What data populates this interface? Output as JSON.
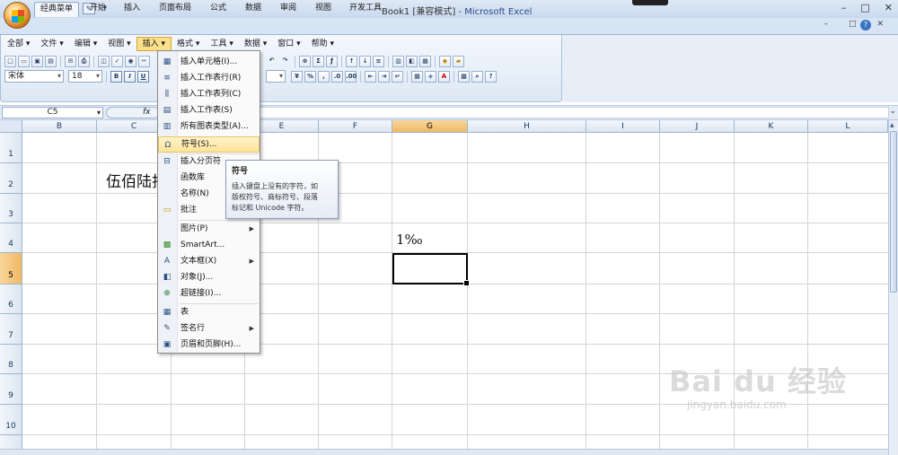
{
  "window": {
    "title": "Book1  [兼容模式]",
    "app": " - Microsoft Excel",
    "controls": [
      "–",
      "□",
      "✕"
    ]
  },
  "ribbon_tabs": [
    "经典菜单",
    "开始",
    "插入",
    "页面布局",
    "公式",
    "数据",
    "审阅",
    "视图",
    "开发工具"
  ],
  "tab_controls": "– □ ✕",
  "classic_menu": [
    "全部",
    "文件",
    "编辑",
    "视图",
    "插入",
    "格式",
    "工具",
    "数据",
    "窗口",
    "帮助"
  ],
  "font": {
    "name": "宋体",
    "size": "18"
  },
  "formula_bar": {
    "cell_ref": "C5",
    "fx": "fx"
  },
  "columns": [
    "B",
    "C",
    "D",
    "E",
    "F",
    "G",
    "H",
    "I",
    "J",
    "K",
    "L"
  ],
  "rows": [
    "1",
    "2",
    "3",
    "4",
    "5",
    "6",
    "7",
    "8",
    "9",
    "10"
  ],
  "cells": {
    "C2": "伍佰陆拾",
    "G4": "1‰"
  },
  "insert_menu": [
    {
      "label": "插入单元格(I)...",
      "icon": "insert-cells-icon",
      "glyph": "▦"
    },
    {
      "label": "插入工作表行(R)",
      "icon": "insert-row-icon",
      "glyph": "≡"
    },
    {
      "label": "插入工作表列(C)",
      "icon": "insert-column-icon",
      "glyph": "⫼"
    },
    {
      "label": "插入工作表(S)",
      "icon": "insert-sheet-icon",
      "glyph": "▤"
    },
    {
      "label": "所有图表类型(A)...",
      "icon": "chart-icon",
      "glyph": "▥"
    },
    {
      "label": "符号(S)...",
      "icon": "omega-icon",
      "glyph": "Ω"
    },
    {
      "label": "插入分页符",
      "icon": "page-break-icon",
      "glyph": "⊟"
    },
    {
      "label": "函数库",
      "icon": "",
      "glyph": ""
    },
    {
      "label": "名称(N)",
      "icon": "",
      "glyph": ""
    },
    {
      "label": "批注",
      "icon": "comment-icon",
      "glyph": "▭"
    },
    {
      "label": "图片(P)",
      "icon": "",
      "glyph": ""
    },
    {
      "label": "SmartArt...",
      "icon": "smartart-icon",
      "glyph": "▩"
    },
    {
      "label": "文本框(X)",
      "icon": "textbox-icon",
      "glyph": "A"
    },
    {
      "label": "对象(J)...",
      "icon": "object-icon",
      "glyph": "◧"
    },
    {
      "label": "超链接(I)...",
      "icon": "hyperlink-icon",
      "glyph": "⊕"
    },
    {
      "label": "表",
      "icon": "table-icon",
      "glyph": "▦"
    },
    {
      "label": "签名行",
      "icon": "signature-icon",
      "glyph": "✎"
    },
    {
      "label": "页眉和页脚(H)...",
      "icon": "header-footer-icon",
      "glyph": "▣"
    }
  ],
  "tooltip": {
    "title": "符号",
    "line1": "插入键盘上没有的字符，如",
    "line2": "版权符号、商标符号、段落",
    "line3": "标记和 Unicode 字符。"
  },
  "watermark": {
    "main": "Bai du 经验",
    "sub": "jingyan.baidu.com"
  }
}
